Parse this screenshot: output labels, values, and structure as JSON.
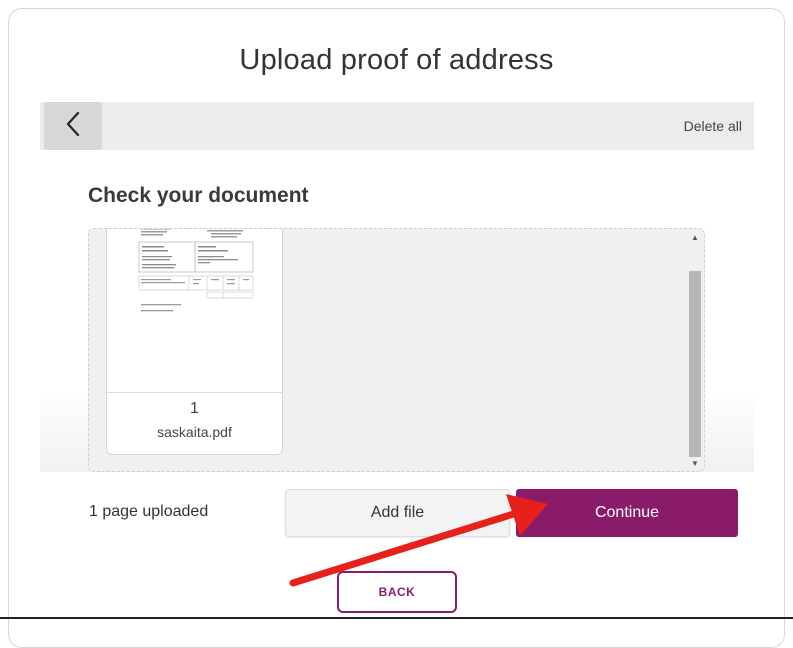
{
  "page": {
    "title": "Upload proof of address"
  },
  "toolbar": {
    "back_icon": "chevron-left-icon",
    "delete_all_label": "Delete all"
  },
  "document": {
    "heading": "Check your document",
    "pages": [
      {
        "page_number": "1",
        "file_name": "saskaita.pdf"
      }
    ]
  },
  "footer": {
    "status_text": "1 page uploaded",
    "add_file_label": "Add file",
    "continue_label": "Continue",
    "back_label": "BACK"
  },
  "colors": {
    "brand": "#8a1a6a",
    "annotation_arrow": "#e8201c",
    "toolbar_bg": "#ececec"
  }
}
